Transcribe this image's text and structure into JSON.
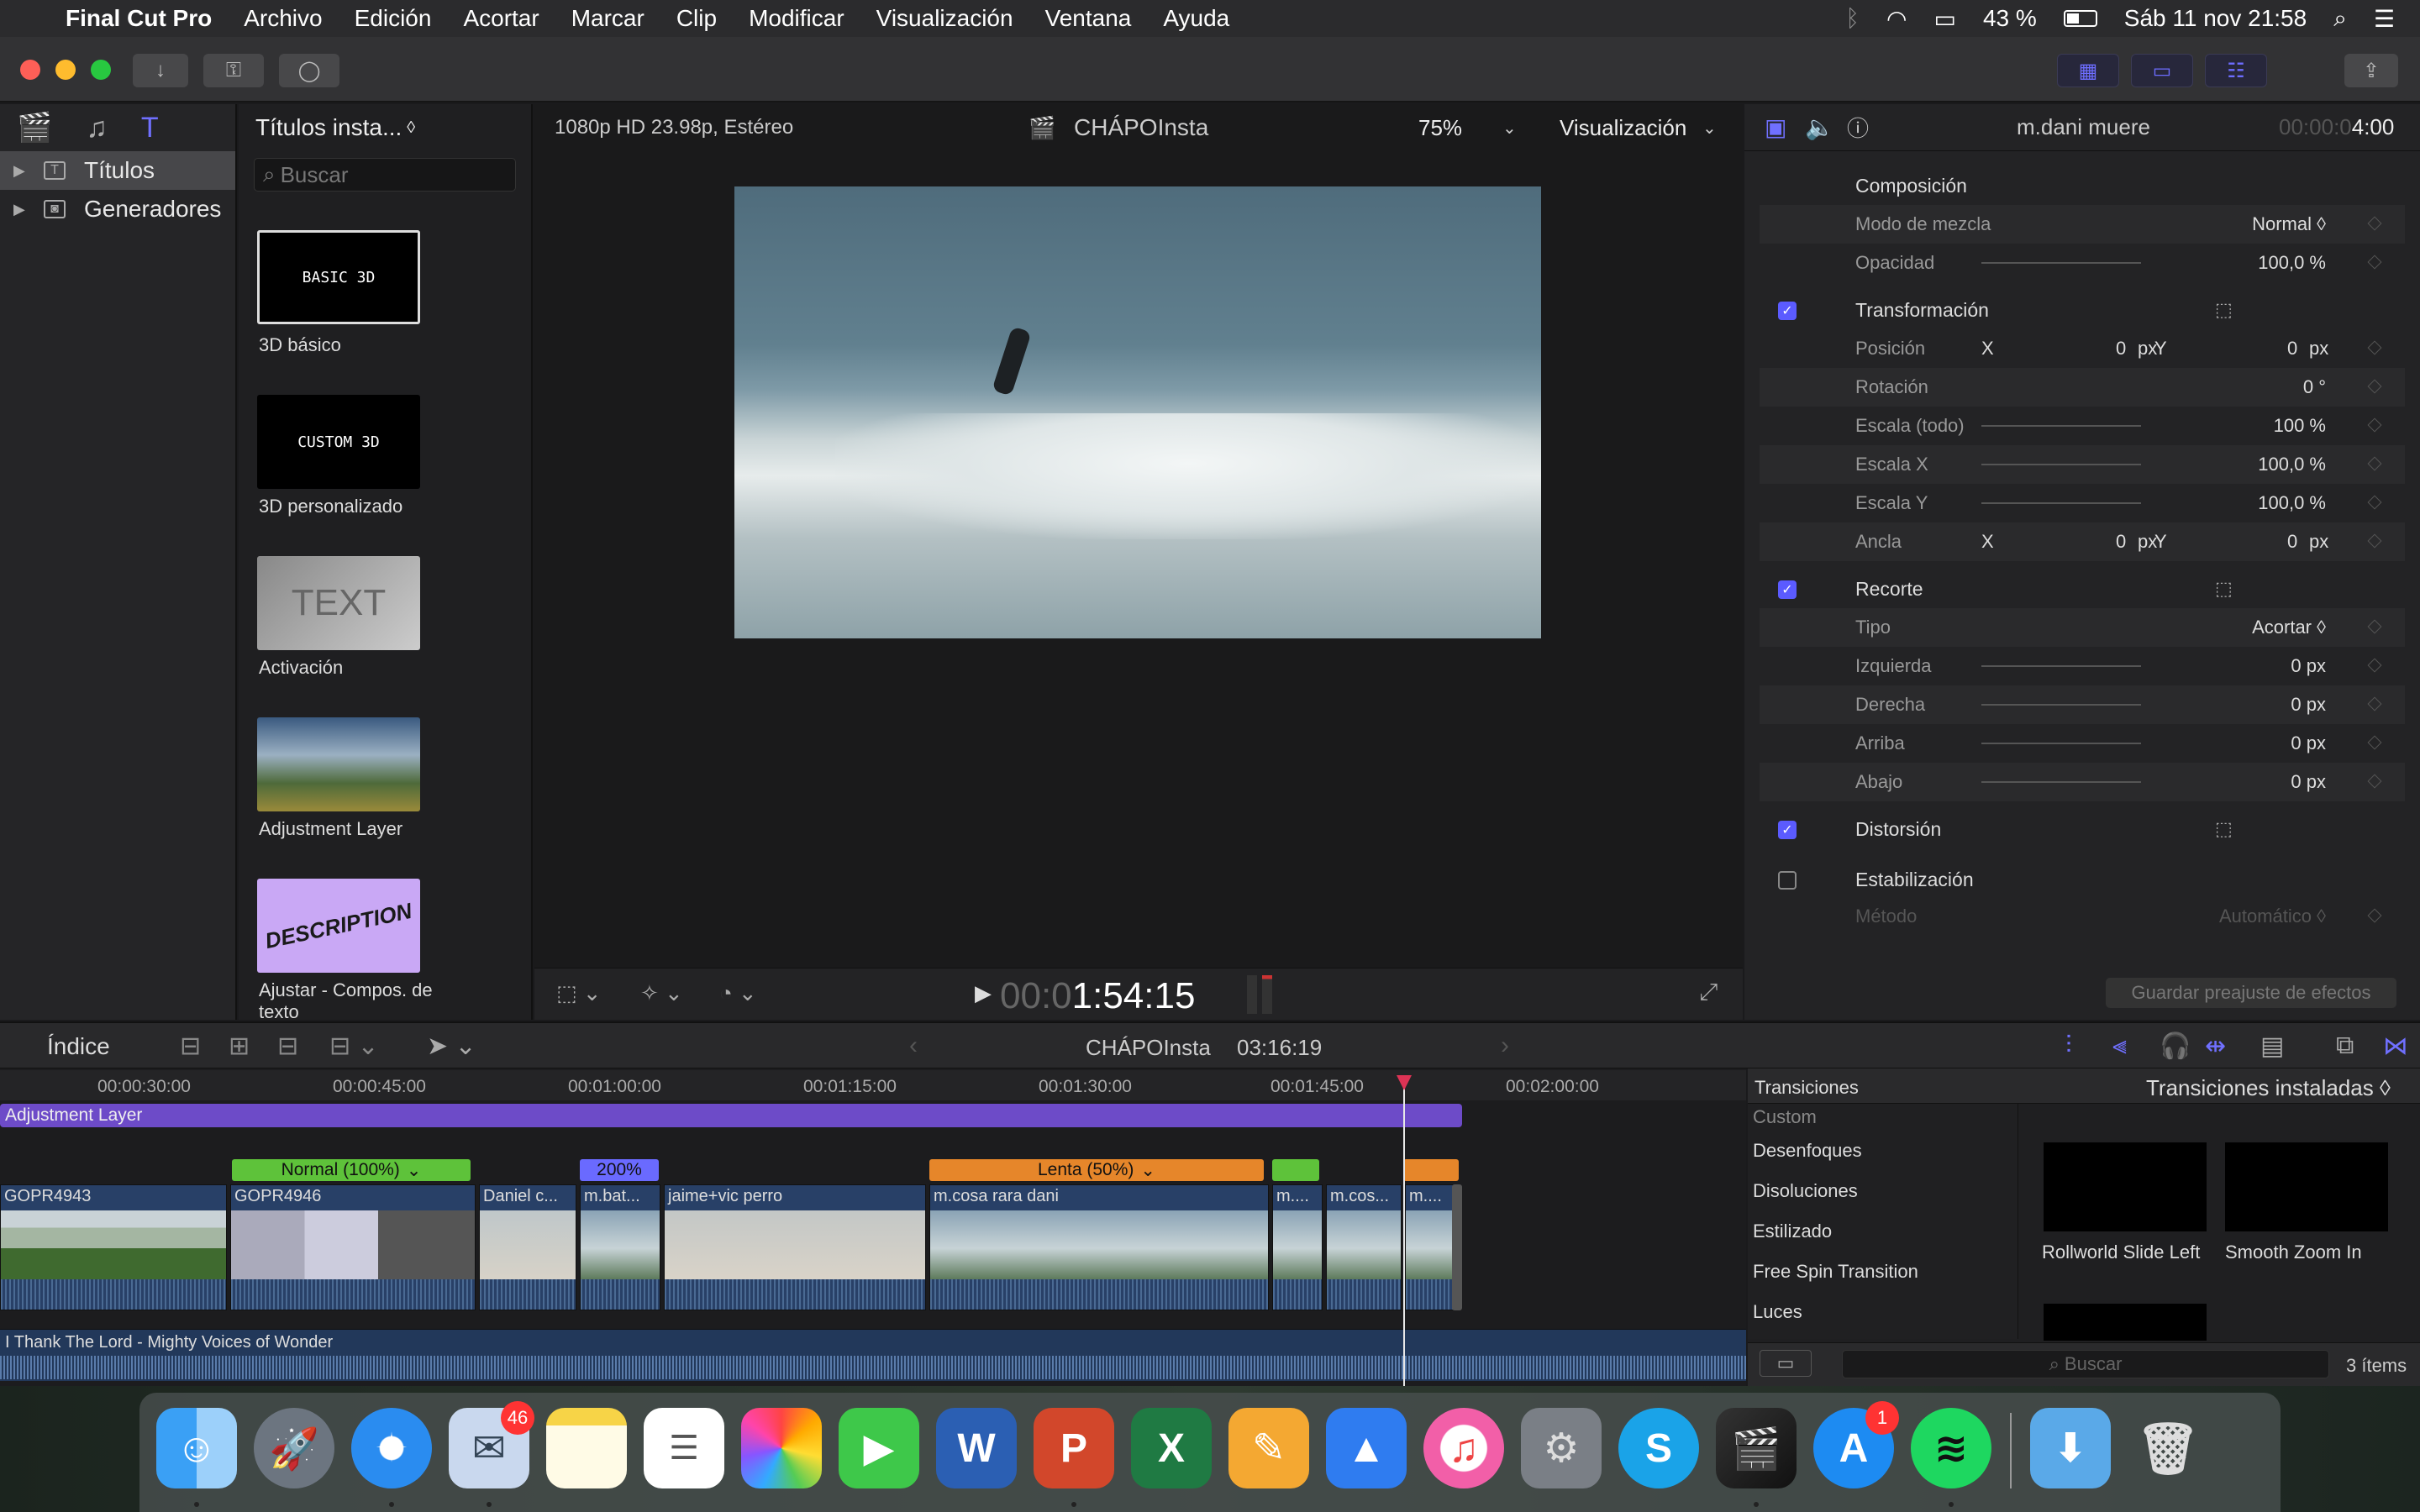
{
  "menubar": {
    "app": "Final Cut Pro",
    "menus": [
      "Archivo",
      "Edición",
      "Acortar",
      "Marcar",
      "Clip",
      "Modificar",
      "Visualización",
      "Ventana",
      "Ayuda"
    ],
    "battery": "43 %",
    "datetime": "Sáb 11 nov  21:58"
  },
  "library": {
    "items": [
      {
        "label": "Títulos",
        "selected": true
      },
      {
        "label": "Generadores",
        "selected": false
      }
    ]
  },
  "browser": {
    "title": "Títulos insta...",
    "search_placeholder": "Buscar",
    "tiles": [
      {
        "label": "3D básico",
        "thumb_text": "BASIC 3D"
      },
      {
        "label": "3D personalizado",
        "thumb_text": "CUSTOM 3D"
      },
      {
        "label": "Activación",
        "thumb_text": "TEXT"
      },
      {
        "label": "Adjustment Layer",
        "thumb_text": ""
      },
      {
        "label": "Ajustar - Compos. de texto",
        "thumb_text": "DESCRIPTION"
      }
    ]
  },
  "viewer": {
    "format": "1080p HD 23.98p, Estéreo",
    "project": "CHÁPOInsta",
    "zoom": "75%",
    "view_menu": "Visualización",
    "timecode_dim": "00:0",
    "timecode": "1:54:15"
  },
  "inspector": {
    "clip_name": "m.dani muere",
    "duration_dim": "00:00:0",
    "duration": "4:00",
    "rows": [
      {
        "label": "Composición",
        "type": "header"
      },
      {
        "label": "Modo de mezcla",
        "value": "Normal ◊"
      },
      {
        "label": "Opacidad",
        "value": "100,0  %"
      },
      {
        "label": "Transformación",
        "type": "section",
        "checked": true
      },
      {
        "label": "Posición",
        "x": "0",
        "y": "0",
        "unit": "px"
      },
      {
        "label": "Rotación",
        "value": "0  °"
      },
      {
        "label": "Escala (todo)",
        "value": "100  %"
      },
      {
        "label": "Escala X",
        "value": "100,0  %"
      },
      {
        "label": "Escala Y",
        "value": "100,0  %"
      },
      {
        "label": "Ancla",
        "x": "0",
        "y": "0",
        "unit": "px"
      },
      {
        "label": "Recorte",
        "type": "section",
        "checked": true
      },
      {
        "label": "Tipo",
        "value": "Acortar ◊"
      },
      {
        "label": "Izquierda",
        "value": "0  px"
      },
      {
        "label": "Derecha",
        "value": "0  px"
      },
      {
        "label": "Arriba",
        "value": "0  px"
      },
      {
        "label": "Abajo",
        "value": "0  px"
      },
      {
        "label": "Distorsión",
        "type": "section",
        "checked": true
      },
      {
        "label": "Estabilización",
        "type": "section",
        "checked": false
      },
      {
        "label": "Método",
        "value": "Automático ◊",
        "dim": true
      }
    ],
    "save_preset": "Guardar preajuste de efectos"
  },
  "timeline": {
    "index": "Índice",
    "project": "CHÁPOInsta",
    "duration": "03:16:19",
    "ruler": [
      "00:00:30:00",
      "00:00:45:00",
      "00:01:00:00",
      "00:01:15:00",
      "00:01:30:00",
      "00:01:45:00",
      "00:02:00:00"
    ],
    "adjustment": "Adjustment Layer",
    "speeds": [
      {
        "label": "Normal (100%)",
        "color": "#5ec23a"
      },
      {
        "label": "200%",
        "color": "#6a6aff"
      },
      {
        "label": "Lenta (50%)",
        "color": "#e6862a"
      }
    ],
    "clips": [
      "GOPR4943",
      "GOPR4946",
      "Daniel c...",
      "m.bat...",
      "jaime+vic perro",
      "m.cosa rara dani",
      "m....",
      "m.cos...",
      "m...."
    ],
    "audio": "I Thank The Lord - Mighty Voices of Wonder"
  },
  "transitions": {
    "header": "Transiciones",
    "installed": "Transiciones instaladas",
    "categories": [
      "Custom",
      "Desenfoques",
      "Disoluciones",
      "Estilizado",
      "Free Spin Transition",
      "Luces"
    ],
    "items": [
      "Rollworld Slide Left",
      "Smooth Zoom In"
    ],
    "search_placeholder": "Buscar",
    "count": "3 ítems"
  },
  "dock": {
    "mail_badge": "46",
    "appstore_badge": "1"
  }
}
